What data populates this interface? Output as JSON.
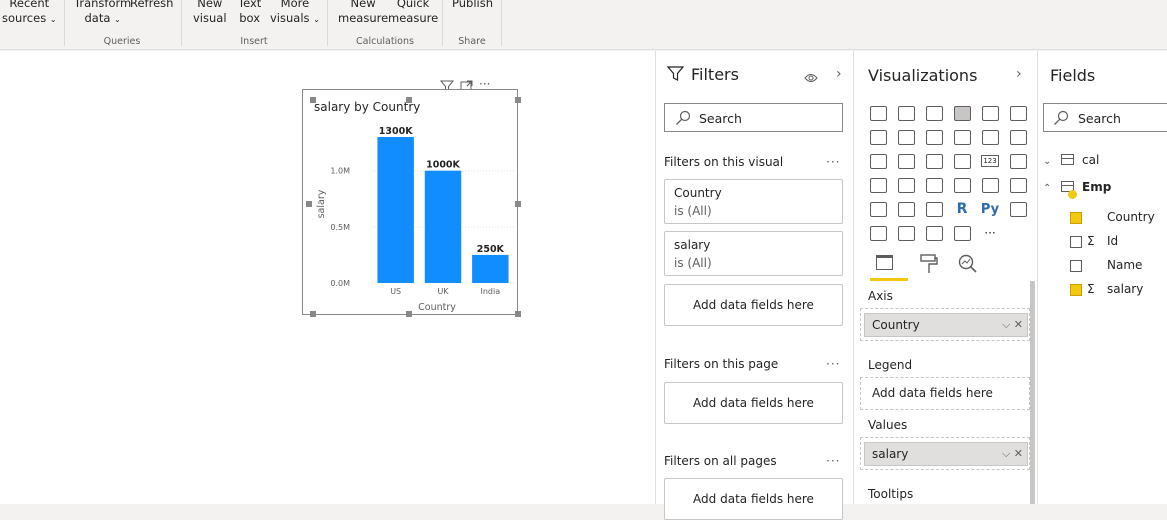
{
  "ribbon": {
    "buttons": [
      {
        "l1": "Recent",
        "l2": "sources"
      },
      {
        "l1": "Transform",
        "l2": "data"
      },
      {
        "l1": "Refresh",
        "l2": ""
      },
      {
        "l1": "New",
        "l2": "visual"
      },
      {
        "l1": "Text",
        "l2": "box"
      },
      {
        "l1": "More",
        "l2": "visuals"
      },
      {
        "l1": "New",
        "l2": "measure"
      },
      {
        "l1": "Quick",
        "l2": "measure"
      },
      {
        "l1": "Publish",
        "l2": ""
      }
    ],
    "groups": [
      "Queries",
      "Insert",
      "Calculations",
      "Share"
    ]
  },
  "visual": {
    "title": "salary by Country",
    "header_icons": [
      "filter-icon",
      "focus-mode-icon",
      "more-options-icon"
    ]
  },
  "chart_data": {
    "type": "bar",
    "categories": [
      "US",
      "UK",
      "India"
    ],
    "values": [
      1300000,
      1000000,
      250000
    ],
    "data_labels": [
      "1300K",
      "1000K",
      "250K"
    ],
    "title": "salary by Country",
    "xlabel": "Country",
    "ylabel": "salary",
    "y_ticks": [
      "0.0M",
      "0.5M",
      "1.0M"
    ],
    "y_tick_values": [
      0,
      500000,
      1000000
    ],
    "ylim": [
      0,
      1300000
    ],
    "bar_color": "#118dff",
    "grid": true
  },
  "filters": {
    "title": "Filters",
    "search_placeholder": "Search",
    "on_visual": "Filters on this visual",
    "cards": [
      {
        "field": "Country",
        "state": "is (All)"
      },
      {
        "field": "salary",
        "state": "is (All)"
      }
    ],
    "add_fields": "Add data fields here",
    "on_page": "Filters on this page",
    "on_all_pages": "Filters on all pages",
    "more": "···"
  },
  "visualizations": {
    "title": "Visualizations",
    "sections": {
      "axis": "Axis",
      "legend": "Legend",
      "values": "Values",
      "tooltips": "Tooltips"
    },
    "axis_field": "Country",
    "values_field": "salary",
    "legend_placeholder": "Add data fields here",
    "grid_labels": [
      "R",
      "Py",
      "123",
      "···"
    ]
  },
  "fields": {
    "title": "Fields",
    "search_placeholder": "Search",
    "tables": [
      {
        "name": "cal",
        "expanded": false
      },
      {
        "name": "Emp",
        "expanded": true,
        "columns": [
          {
            "name": "Country",
            "checked": true,
            "sigma": false
          },
          {
            "name": "Id",
            "checked": false,
            "sigma": true
          },
          {
            "name": "Name",
            "checked": false,
            "sigma": false
          },
          {
            "name": "salary",
            "checked": true,
            "sigma": true
          }
        ]
      }
    ],
    "sigma": "Σ"
  },
  "colors": {
    "accent": "#f2c811",
    "bar": "#118dff"
  }
}
